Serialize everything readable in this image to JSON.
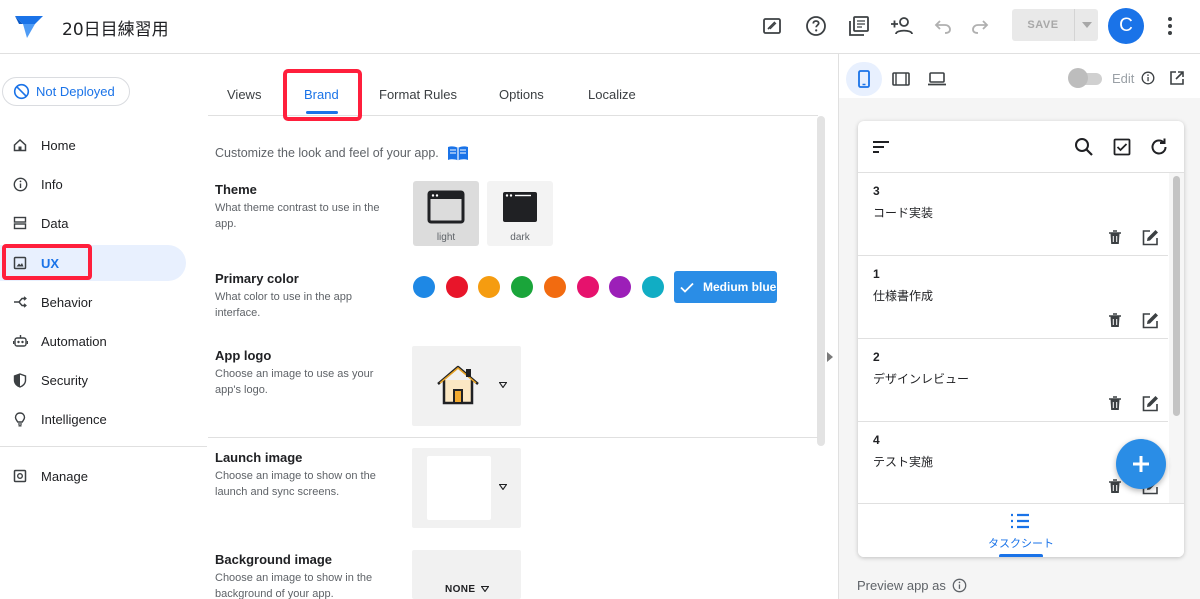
{
  "header": {
    "app_title": "20日目練習用",
    "save_label": "SAVE",
    "avatar_initial": "C"
  },
  "sidebar": {
    "deploy_status": "Not Deployed",
    "items": [
      {
        "label": "Home",
        "icon": "home-icon"
      },
      {
        "label": "Info",
        "icon": "info-icon"
      },
      {
        "label": "Data",
        "icon": "data-icon"
      },
      {
        "label": "UX",
        "icon": "ux-icon"
      },
      {
        "label": "Behavior",
        "icon": "behavior-icon"
      },
      {
        "label": "Automation",
        "icon": "automation-icon"
      },
      {
        "label": "Security",
        "icon": "shield-icon"
      },
      {
        "label": "Intelligence",
        "icon": "lightbulb-icon"
      }
    ],
    "manage_label": "Manage"
  },
  "tabs": [
    "Views",
    "Brand",
    "Format Rules",
    "Options",
    "Localize"
  ],
  "brand": {
    "intro": "Customize the look and feel of your app.",
    "theme": {
      "title": "Theme",
      "desc": "What theme contrast to use in the app.",
      "options": [
        "light",
        "dark"
      ]
    },
    "primary_color": {
      "title": "Primary color",
      "desc": "What color to use in the app interface.",
      "swatches": [
        "#1e88e5",
        "#e8152a",
        "#f59c10",
        "#1aa53a",
        "#f26b10",
        "#e6126d",
        "#9c1fb8",
        "#11adc4"
      ],
      "selected": "Medium blue",
      "selected_color": "#2a8de6"
    },
    "app_logo": {
      "title": "App logo",
      "desc": "Choose an image to use as your app's logo."
    },
    "launch_image": {
      "title": "Launch image",
      "desc": "Choose an image to show on the launch and sync screens."
    },
    "background_image": {
      "title": "Background image",
      "desc": "Choose an image to show in the background of your app.",
      "value": "NONE"
    }
  },
  "preview": {
    "edit_label": "Edit",
    "rows": [
      {
        "num": "3",
        "text": "コード実装"
      },
      {
        "num": "1",
        "text": "仕様書作成"
      },
      {
        "num": "2",
        "text": "デザインレビュー"
      },
      {
        "num": "4",
        "text": "テスト実施"
      }
    ],
    "bottom_tab": "タスクシート",
    "preview_as": "Preview app as"
  },
  "colors": {
    "accent": "#1a73e8",
    "highlight": "#ff1f3c"
  }
}
